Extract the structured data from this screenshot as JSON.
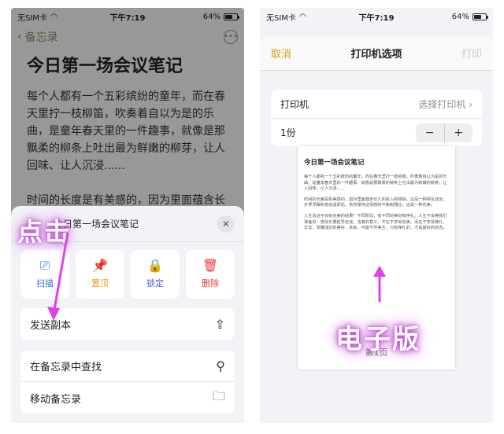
{
  "left_screen": {
    "status": {
      "carrier": "无SIM卡",
      "time": "下午7:19",
      "battery": "64%",
      "battery_level": 0.64
    },
    "nav": {
      "back_label": "备忘录",
      "more_icon": "ellipsis-circle-icon"
    },
    "note": {
      "title": "今日第一场会议笔记",
      "paragraphs": [
        "每个人都有一个五彩缤纷的童年，而在春天里拧一枝柳笛，吹奏着自以为是的乐曲，是童年春天里的一件趣事，就像是那飘柔的柳条上吐出最为鲜嫩的柳芽，让人回味、让人沉浸......",
        "时间的长度是有美感的，因为里面蕴含长久的投入和相信。这是一种相互成全。外"
      ]
    },
    "sheet": {
      "title": "今日第一场会议笔记",
      "close_icon": "close-icon",
      "actions": [
        {
          "label": "扫描",
          "icon": "scan-icon",
          "color": "#2f6fde"
        },
        {
          "label": "置顶",
          "icon": "pin-icon",
          "color": "#f0a020"
        },
        {
          "label": "锁定",
          "icon": "lock-icon",
          "color": "#5a5ad6"
        },
        {
          "label": "删除",
          "icon": "trash-icon",
          "color": "#e53935"
        }
      ],
      "send_copy": "发送副本",
      "find_in_notes": "在备忘录中查找",
      "move_note": "移动备忘录"
    },
    "callout": "点击"
  },
  "right_screen": {
    "status": {
      "carrier": "无SIM卡",
      "time": "下午7:19",
      "battery": "64%",
      "battery_level": 0.64
    },
    "header": {
      "cancel": "取消",
      "title": "打印机选项",
      "print": "打印"
    },
    "printer": {
      "label": "打印机",
      "value": "选择打印机"
    },
    "copies": {
      "label": "1份",
      "minus": "−",
      "plus": "+"
    },
    "preview": {
      "title": "今日第一场会议笔记",
      "paragraphs": [
        "每个人都有一个五彩缤纷的童年，而在春天里拧一枝柳笛，吹奏着自以为是的乐曲，是童年春天里的一件趣事，就像是那飘柔的柳条上吐出最为鲜嫩的柳芽，让人回味、让人沉浸......",
        "时间的长度是有美感的，因为里面蕴含长久的投入和相信。这是一种相互成全，外界浮躁和变动逼却后，依然保持这情感的平衡和强壮，这是一种优美。",
        "人生永远不会有完美的结果！不同阶段，有不同的美好和挣扎。人生不会等我们准备好，想快乐要趁早去找，活着的意义，不在于享受完美，而在于享受挣扎、过去、零雕成幻的美好、未来，可能不尽美生，只有挣扎的，才是最好的状态。"
      ],
      "page_label": "第1页"
    },
    "callout": "电子版"
  }
}
